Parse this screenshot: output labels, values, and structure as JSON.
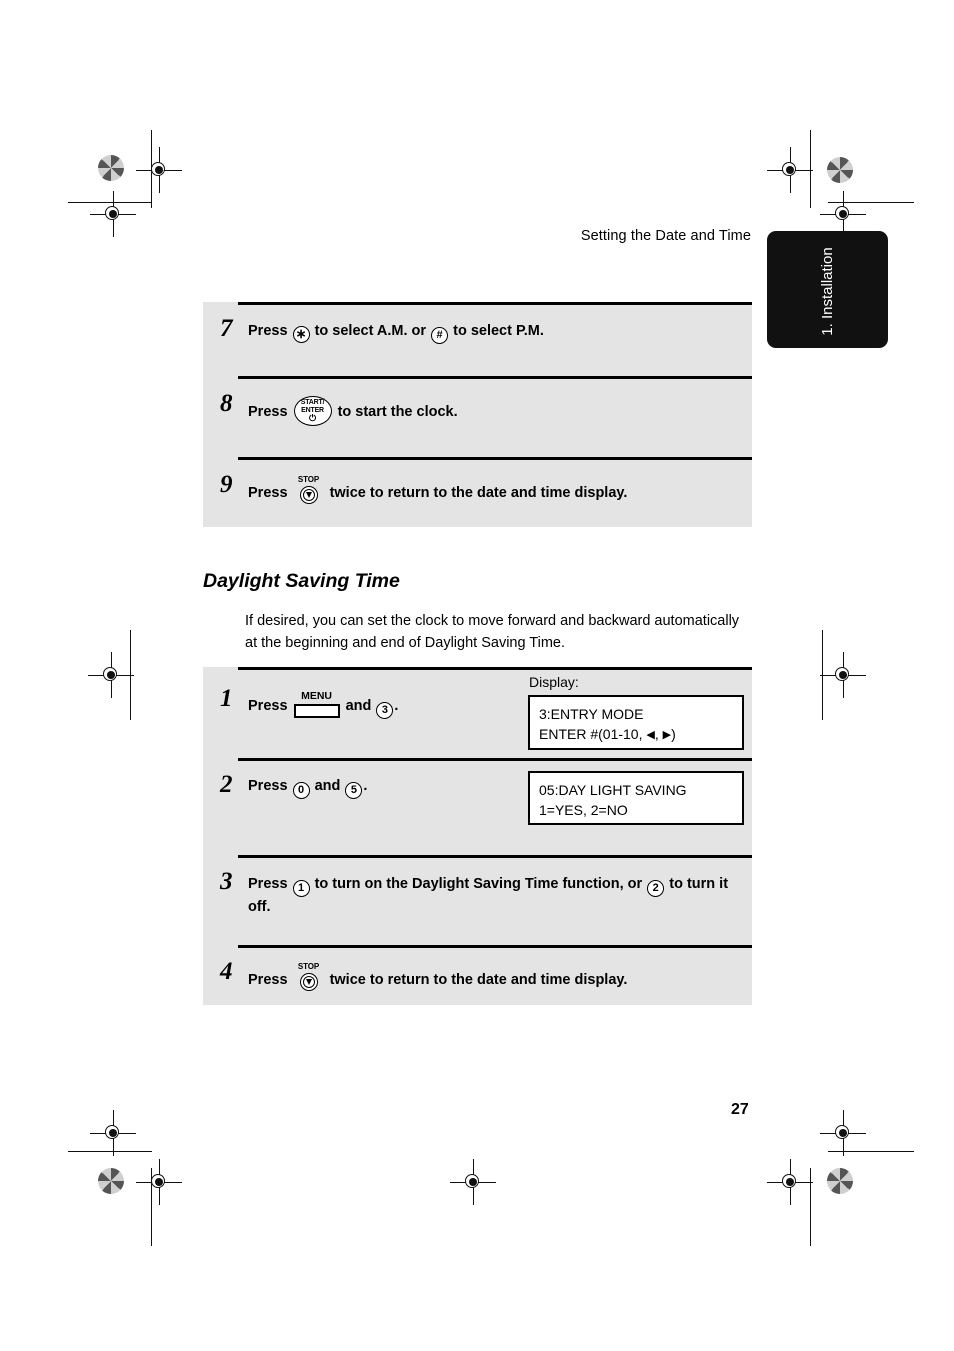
{
  "page": {
    "running_head": "Setting the Date and Time",
    "chapter_tab": "1. Installation",
    "page_number": "27"
  },
  "top_steps": [
    {
      "number": "7",
      "text_before": "Press",
      "key1": "∗",
      "text_mid": "to select A.M. or",
      "key2": "#",
      "text_after": "to select P.M."
    },
    {
      "number": "8",
      "text_before": "Press",
      "key_line1": "START/",
      "key_line2": "ENTER",
      "key_glyph": "⏻",
      "text_after": "to start the clock."
    },
    {
      "number": "9",
      "text_before": "Press",
      "key_cap": "STOP",
      "text_after": "twice to return to the date and time display."
    }
  ],
  "section": {
    "heading": "Daylight Saving Time",
    "intro": "If desired, you can set the clock to move forward and backward automatically at the beginning and end of Daylight Saving Time."
  },
  "dst_steps": [
    {
      "number": "1",
      "text_before": "Press",
      "key_menu": "MENU",
      "text_mid": "and",
      "key2": "3",
      "text_after": ".",
      "display_label": "Display:",
      "display_line1": "3:ENTRY MODE",
      "display_line2_a": "ENTER #(01-10,",
      "display_line2_left_arrow": "◀",
      "display_line2_b": ",",
      "display_line2_right_arrow": "▶",
      "display_line2_c": ")"
    },
    {
      "number": "2",
      "text_before": "Press",
      "key1": "0",
      "text_mid": "and",
      "key2": "5",
      "text_after": ".",
      "display_line1": "05:DAY LIGHT SAVING",
      "display_line2": "1=YES, 2=NO"
    },
    {
      "number": "3",
      "text_before": "Press",
      "key1": "1",
      "text_mid": "to turn on the Daylight Saving Time function, or",
      "key2": "2",
      "text_after": "to turn it off."
    },
    {
      "number": "4",
      "text_before": "Press",
      "key_cap": "STOP",
      "text_after": "twice to return to the date and time display."
    }
  ],
  "colors": {
    "panel_gray": "#e4e4e4",
    "tab_black": "#111111",
    "rule_black": "#000000"
  }
}
